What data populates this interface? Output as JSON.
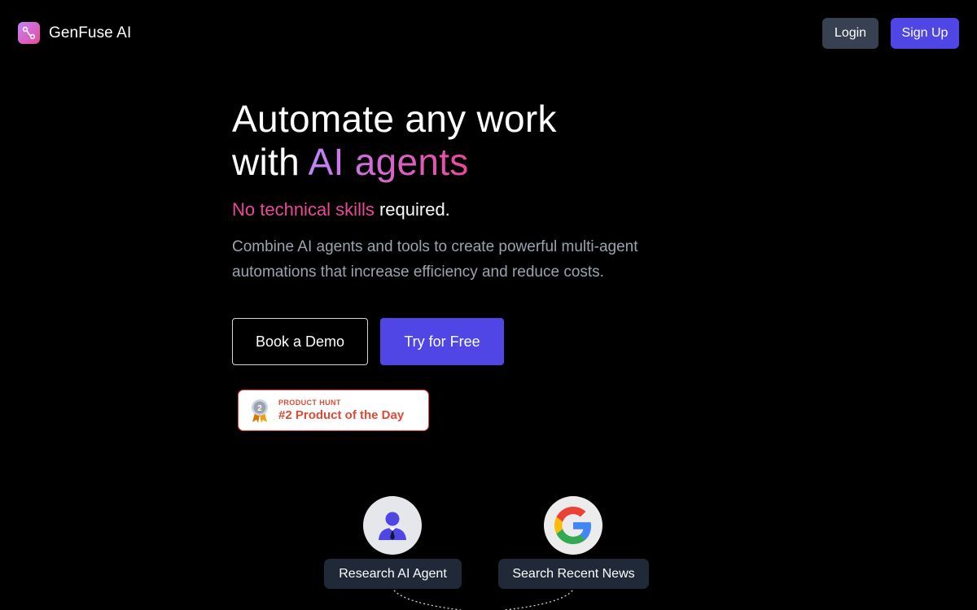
{
  "header": {
    "brand_name": "GenFuse AI",
    "logo_icon": "workflow-nodes-icon",
    "login_label": "Login",
    "signup_label": "Sign Up"
  },
  "hero": {
    "title_line1": "Automate any work",
    "title_line2_prefix": "with ",
    "title_line2_highlight": "AI agents",
    "subtitle_accent": "No technical skills",
    "subtitle_rest": " required.",
    "description": "Combine AI agents and tools to create powerful multi-agent automations that increase efficiency and reduce costs.",
    "demo_button_label": "Book a Demo",
    "try_button_label": "Try for Free"
  },
  "product_hunt": {
    "label_top": "PRODUCT HUNT",
    "label_bottom": "#2 Product of the Day",
    "medal_number": "2"
  },
  "flow": {
    "nodes": [
      {
        "label": "Research AI Agent",
        "icon": "agent-person-icon"
      },
      {
        "label": "Search Recent News",
        "icon": "google-icon"
      }
    ]
  },
  "colors": {
    "background": "#000000",
    "primary": "#4f46e5",
    "login_bg": "#374151",
    "accent_pink": "#ec4899",
    "accent_purple": "#c084fc",
    "muted_text": "#9ca3af",
    "node_label_bg": "#1f2937",
    "badge_red": "#dc4a38"
  }
}
